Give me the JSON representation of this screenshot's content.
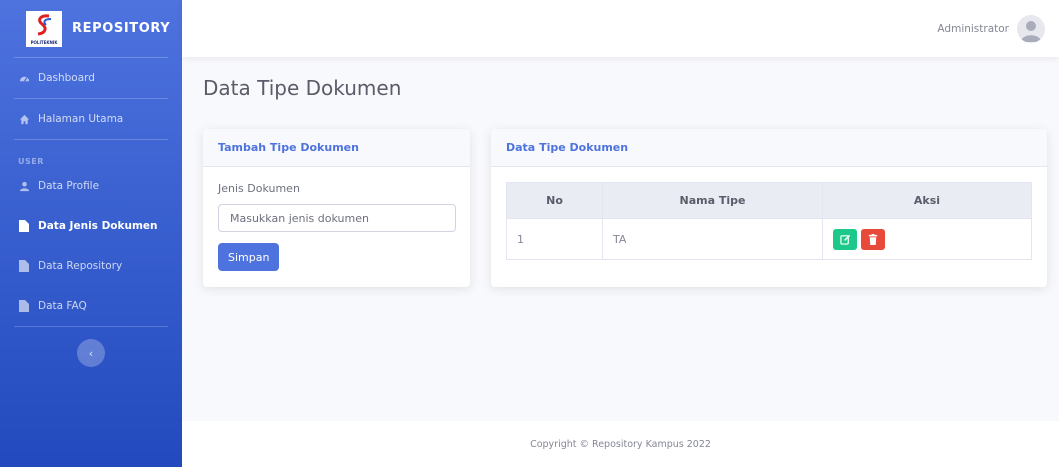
{
  "brand": {
    "name": "REPOSITORY",
    "logo_text": "POLITEKNIK"
  },
  "sidebar": {
    "items_top": [
      {
        "label": "Dashboard",
        "icon": "dashboard-icon"
      },
      {
        "label": "Halaman Utama",
        "icon": "home-icon"
      }
    ],
    "heading": "USER",
    "items_user": [
      {
        "label": "Data Profile",
        "icon": "user-icon"
      },
      {
        "label": "Data Jenis Dokumen",
        "icon": "file-icon",
        "active": true
      },
      {
        "label": "Data Repository",
        "icon": "file-icon"
      },
      {
        "label": "Data FAQ",
        "icon": "file-icon"
      }
    ],
    "toggle": "‹"
  },
  "topbar": {
    "user_name": "Administrator"
  },
  "page": {
    "title": "Data Tipe Dokumen"
  },
  "form": {
    "title": "Tambah Tipe Dokumen",
    "label": "Jenis Dokumen",
    "placeholder": "Masukkan jenis dokumen",
    "submit_label": "Simpan"
  },
  "table": {
    "title": "Data Tipe Dokumen",
    "columns": [
      "No",
      "Nama Tipe",
      "Aksi"
    ],
    "rows": [
      {
        "no": "1",
        "nama": "TA"
      }
    ]
  },
  "footer": {
    "text": "Copyright © Repository Kampus 2022"
  },
  "colors": {
    "primary": "#4e73df",
    "success": "#1cc88a",
    "danger": "#e74a3b"
  }
}
